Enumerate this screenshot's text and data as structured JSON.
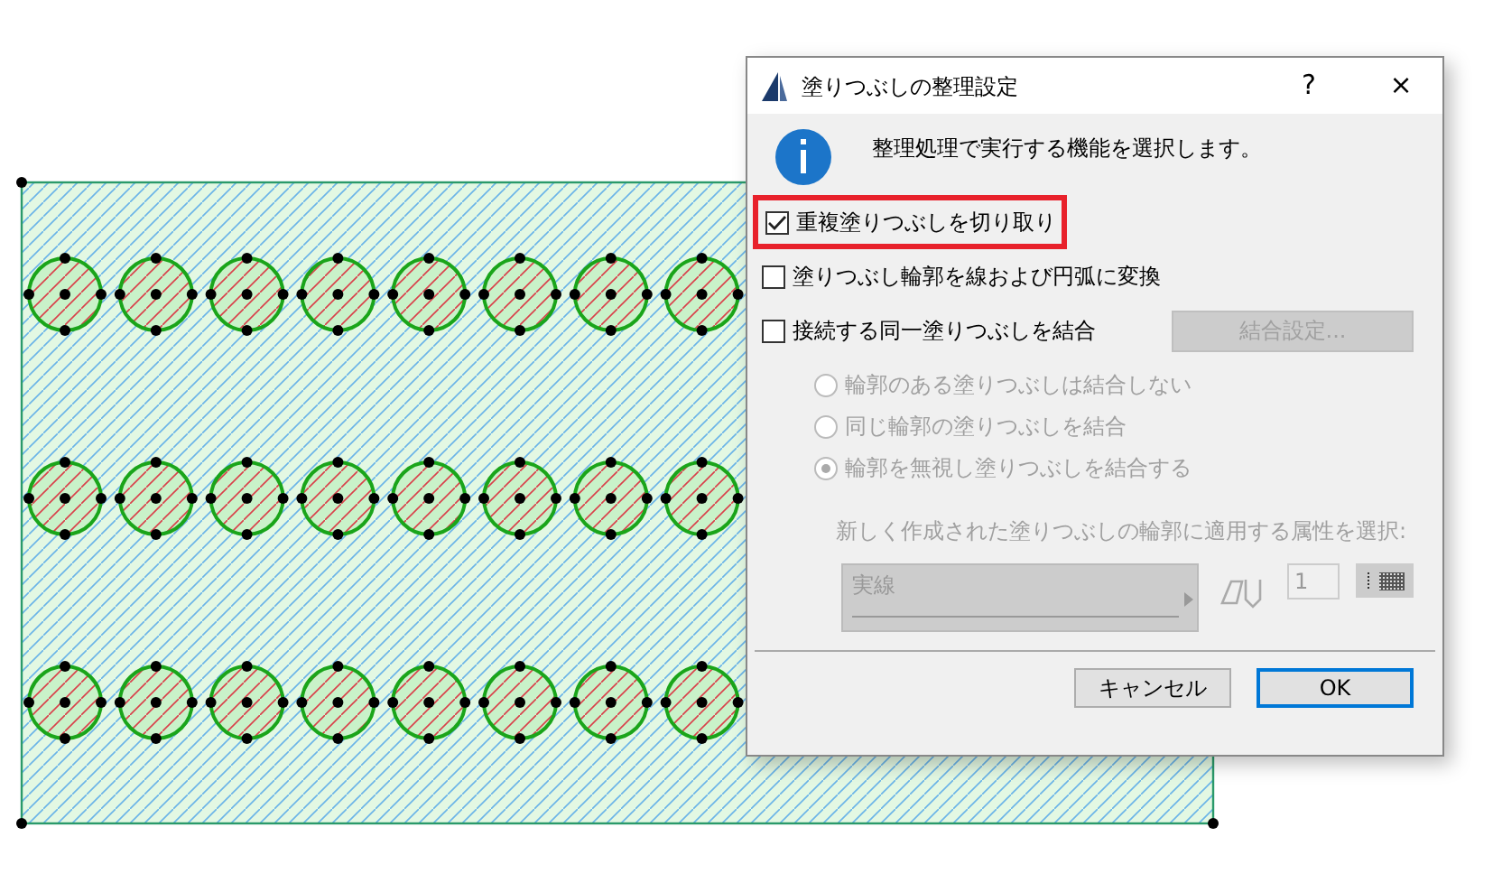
{
  "window": {
    "title": "塗りつぶしの整理設定",
    "help": "?",
    "close": "×"
  },
  "message": "整理処理で実行する機能を選択します。",
  "options": [
    {
      "label": "重複塗りつぶしを切り取り",
      "checked": true,
      "highlighted": true
    },
    {
      "label": "塗りつぶし輪郭を線および円弧に変換",
      "checked": false,
      "highlighted": false
    },
    {
      "label": "接続する同一塗りつぶしを結合",
      "checked": false,
      "highlighted": false
    }
  ],
  "merge_settings_button": {
    "label": "結合設定...",
    "disabled": true
  },
  "merge_modes": [
    {
      "label": "輪郭のある塗りつぶしは結合しない",
      "selected": false,
      "disabled": true
    },
    {
      "label": "同じ輪郭の塗りつぶしを結合",
      "selected": false,
      "disabled": true
    },
    {
      "label": "輪郭を無視し塗りつぶしを結合する",
      "selected": true,
      "disabled": true
    }
  ],
  "attribute_label": "新しく作成された塗りつぶしの輪郭に適用する属性を選択:",
  "line_type": {
    "value": "実線",
    "disabled": true
  },
  "pen_number": {
    "value": "1",
    "disabled": true
  },
  "buttons": [
    {
      "label": "キャンセル",
      "default": false
    },
    {
      "label": "OK",
      "default": true
    }
  ]
}
